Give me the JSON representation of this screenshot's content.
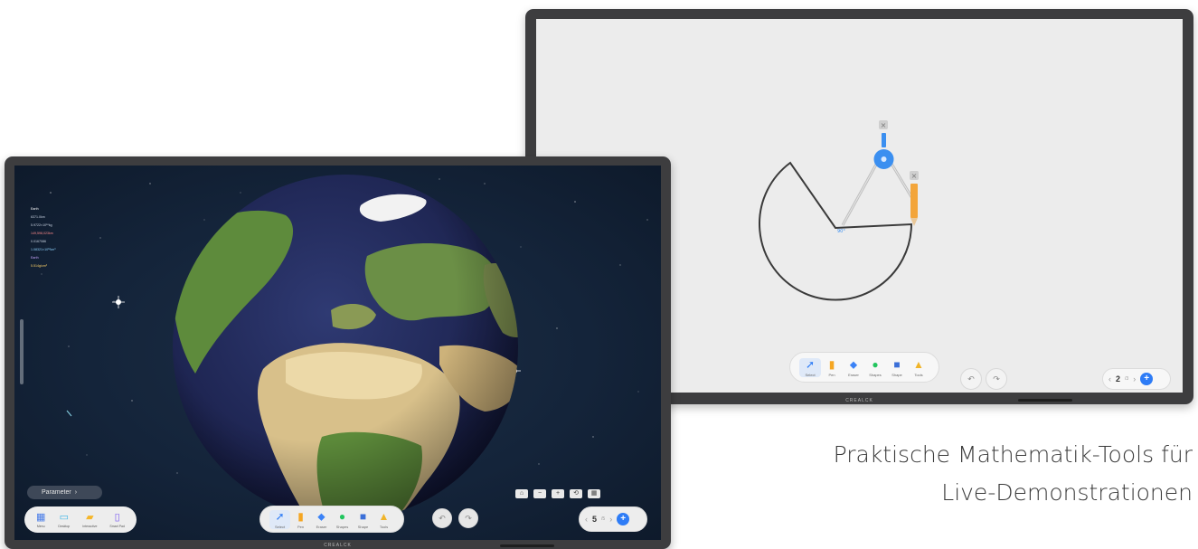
{
  "caption": {
    "line1": "Praktische Mathematik-Tools für",
    "line2": "Live-Demonstrationen"
  },
  "whiteboard": {
    "brand": "CREALCK",
    "toolbar": [
      {
        "label": "Select",
        "icon": "cursor-arrow-icon",
        "glyph": "➚",
        "color": "#2e7cf6"
      },
      {
        "label": "Pen",
        "icon": "pen-icon",
        "glyph": "▮",
        "color": "#f5a623"
      },
      {
        "label": "Eraser",
        "icon": "eraser-icon",
        "glyph": "⬥",
        "color": "#3b82f6"
      },
      {
        "label": "Shapes",
        "icon": "map-pin-icon",
        "glyph": "●",
        "color": "#22c55e"
      },
      {
        "label": "Shape",
        "icon": "shapes-icon",
        "glyph": "■",
        "color": "#3b6fd8"
      },
      {
        "label": "Tools",
        "icon": "toolbox-icon",
        "glyph": "▲",
        "color": "#f0b429"
      }
    ],
    "undo_icon": "undo-icon",
    "redo_icon": "redo-icon",
    "pager": {
      "current": "2",
      "total": "/3",
      "prev": "‹",
      "next": "›",
      "add": "+"
    },
    "compass_degree": "90°"
  },
  "globe_screen": {
    "brand": "CREALCK",
    "info": [
      "Earth",
      "6371.0km",
      "5.9722×10²⁴kg",
      "149,598,023km",
      "0.0167086",
      "1.08321×10¹²km³",
      "Earth",
      "5.514g/cm³"
    ],
    "parameter_button": "Parameter",
    "controls": [
      "⌂",
      "−",
      "+",
      "⟲",
      "▦"
    ],
    "dock": [
      {
        "label": "Menu",
        "icon": "menu-grid-icon",
        "glyph": "▦",
        "color": "#4a7de8"
      },
      {
        "label": "Desktop",
        "icon": "desktop-icon",
        "glyph": "▭",
        "color": "#3bb4e6"
      },
      {
        "label": "Interactive",
        "icon": "folder-icon",
        "glyph": "▰",
        "color": "#f5b62a"
      },
      {
        "label": "Smart Pad",
        "icon": "tablet-icon",
        "glyph": "▯",
        "color": "#7b5cf0"
      }
    ],
    "toolbar": [
      {
        "label": "Select",
        "icon": "cursor-arrow-icon",
        "glyph": "➚",
        "color": "#2e7cf6"
      },
      {
        "label": "Pen",
        "icon": "pen-icon",
        "glyph": "▮",
        "color": "#f5a623"
      },
      {
        "label": "Eraser",
        "icon": "eraser-icon",
        "glyph": "⬥",
        "color": "#3b82f6"
      },
      {
        "label": "Shapes",
        "icon": "map-pin-icon",
        "glyph": "●",
        "color": "#22c55e"
      },
      {
        "label": "Shape",
        "icon": "shapes-icon",
        "glyph": "■",
        "color": "#3b6fd8"
      },
      {
        "label": "Tools",
        "icon": "toolbox-icon",
        "glyph": "▲",
        "color": "#f0b429"
      }
    ],
    "pager": {
      "current": "5",
      "total": "/5",
      "prev": "‹",
      "next": "›",
      "add": "+"
    }
  }
}
